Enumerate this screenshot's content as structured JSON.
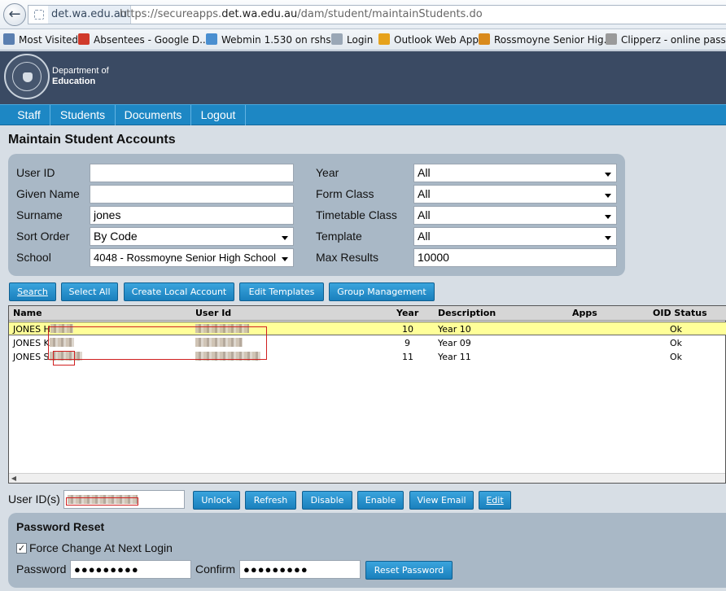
{
  "browser": {
    "domain": "det.wa.edu.au",
    "url_prefix": "https://secureapps.",
    "url_host": "det.wa.edu.au",
    "url_path": "/dam/student/maintainStudents.do",
    "bookmarks": [
      {
        "label": "Most Visited",
        "color": "#5a7fb0"
      },
      {
        "label": "Absentees - Google D...",
        "color": "#d03a2b"
      },
      {
        "label": "Webmin 1.530 on rshs...",
        "color": "#4a8fd0"
      },
      {
        "label": "Login",
        "color": "#9aa7b6"
      },
      {
        "label": "Outlook Web App",
        "color": "#e6a21c"
      },
      {
        "label": "Rossmoyne Senior Hig...",
        "color": "#d98a1c"
      },
      {
        "label": "Clipperz - online pass...",
        "color": "#9a9a9a"
      }
    ]
  },
  "header": {
    "dept_line1": "Department of",
    "dept_line2": "Education"
  },
  "nav": [
    "Staff",
    "Students",
    "Documents",
    "Logout"
  ],
  "page_title": "Maintain Student Accounts",
  "search": {
    "user_id_label": "User ID",
    "user_id_value": "",
    "given_name_label": "Given Name",
    "given_name_value": "",
    "surname_label": "Surname",
    "surname_value": "jones",
    "sort_order_label": "Sort Order",
    "sort_order_value": "By Code",
    "school_label": "School",
    "school_value": "4048 - Rossmoyne Senior High School",
    "year_label": "Year",
    "year_value": "All",
    "form_class_label": "Form Class",
    "form_class_value": "All",
    "timetable_class_label": "Timetable Class",
    "timetable_class_value": "All",
    "template_label": "Template",
    "template_value": "All",
    "max_results_label": "Max Results",
    "max_results_value": "10000"
  },
  "action_buttons": [
    "Search",
    "Select All",
    "Create Local Account",
    "Edit Templates",
    "Group Management"
  ],
  "table": {
    "headers": [
      "Name",
      "User Id",
      "Year",
      "Description",
      "Apps",
      "OID Status"
    ],
    "rows": [
      {
        "name": "JONES H",
        "year": "10",
        "description": "Year 10",
        "apps": "",
        "status": "Ok",
        "selected": true
      },
      {
        "name": "JONES K",
        "year": "9",
        "description": "Year 09",
        "apps": "",
        "status": "Ok",
        "selected": false
      },
      {
        "name": "JONES S",
        "year": "11",
        "description": "Year 11",
        "apps": "",
        "status": "Ok",
        "selected": false
      }
    ]
  },
  "userids": {
    "label": "User ID(s)",
    "buttons": [
      "Unlock",
      "Refresh",
      "Disable",
      "Enable",
      "View Email",
      "Edit"
    ]
  },
  "password_reset": {
    "title": "Password Reset",
    "force_change_label": "Force Change At Next Login",
    "force_change_checked": true,
    "password_label": "Password",
    "password_value": "●●●●●●●●●",
    "confirm_label": "Confirm",
    "confirm_value": "●●●●●●●●●",
    "reset_button": "Reset Password"
  }
}
